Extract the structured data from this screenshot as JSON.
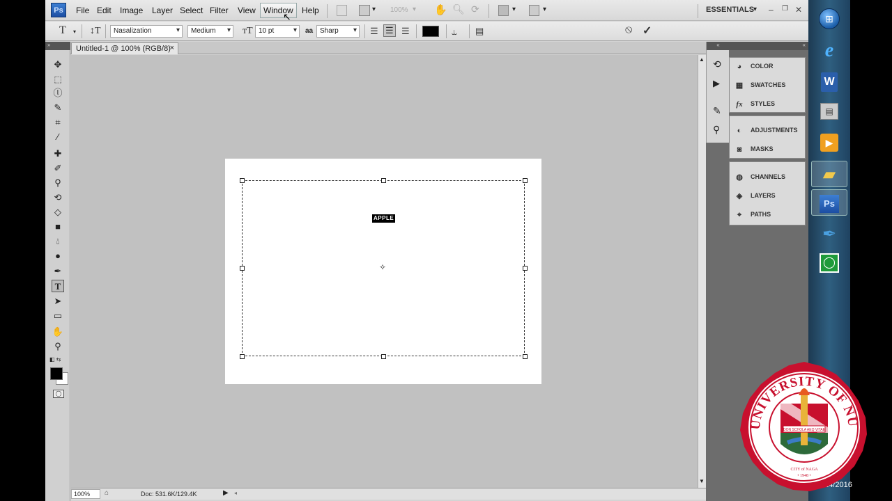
{
  "menubar": {
    "logo": "Ps",
    "items": [
      "File",
      "Edit",
      "Image",
      "Layer",
      "Select",
      "Filter",
      "View",
      "Window",
      "Help"
    ],
    "active_item": "Window",
    "zoom": "100%",
    "workspace": "ESSENTIALS",
    "window_controls": [
      "–",
      "❐",
      "✕"
    ]
  },
  "options": {
    "font_family": "Nasalization",
    "font_style": "Medium",
    "font_size": "10 pt",
    "antialias_prefix": "aa",
    "antialias": "Sharp",
    "text_color": "#000000"
  },
  "document_tab": {
    "title": "Untitled-1 @ 100% (RGB/8)",
    "close": "×"
  },
  "canvas": {
    "text_content": "APPLE"
  },
  "status": {
    "zoom": "100%",
    "doc": "Doc: 531.6K/129.4K"
  },
  "panels": {
    "group1": [
      "COLOR",
      "SWATCHES",
      "STYLES"
    ],
    "group2": [
      "ADJUSTMENTS",
      "MASKS"
    ],
    "group3": [
      "CHANNELS",
      "LAYERS",
      "PATHS"
    ]
  },
  "taskbar": {
    "icons": [
      "windows-start-icon",
      "internet-explorer-icon",
      "word-icon",
      "window-icon",
      "media-player-icon",
      "folder-icon",
      "photoshop-icon",
      "pen-app-icon",
      "green-app-icon"
    ],
    "clock_partial": "/24/2016"
  },
  "seal": {
    "text": "UNIVERSITY OF NUEVA CACERES",
    "motto": "DON SCHOLA AEQ VITAE",
    "city": "CITY of NAGA",
    "year": "1948"
  },
  "colors": {
    "canvas_bg": "#c1c1c1",
    "panel_bg": "#dadada",
    "seal_red": "#c8102e"
  }
}
